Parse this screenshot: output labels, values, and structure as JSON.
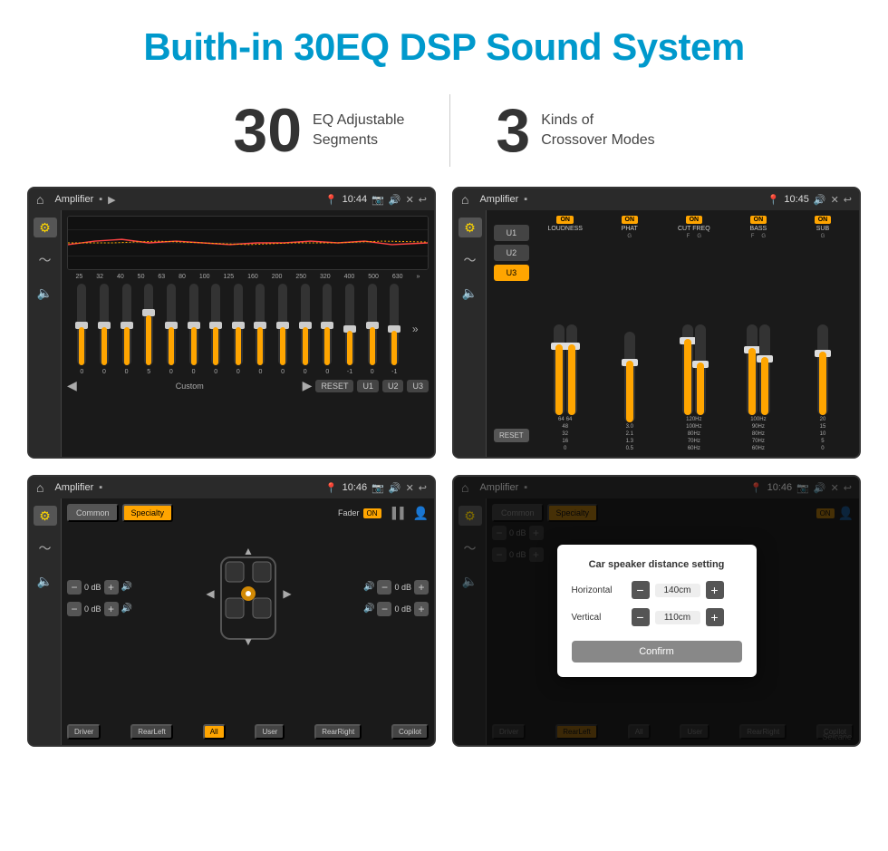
{
  "header": {
    "title": "Buith-in 30EQ DSP Sound System"
  },
  "stats": [
    {
      "number": "30",
      "label": "EQ Adjustable\nSegments"
    },
    {
      "number": "3",
      "label": "Kinds of\nCrossover Modes"
    }
  ],
  "screens": [
    {
      "id": "eq-screen",
      "statusBar": {
        "title": "Amplifier",
        "time": "10:44"
      },
      "type": "equalizer",
      "eqBands": [
        "25",
        "32",
        "40",
        "50",
        "63",
        "80",
        "100",
        "125",
        "160",
        "200",
        "250",
        "320",
        "400",
        "500",
        "630"
      ],
      "eqValues": [
        0,
        0,
        0,
        5,
        0,
        0,
        0,
        0,
        0,
        0,
        0,
        0,
        -1,
        0,
        -1
      ],
      "bottomButtons": [
        "Custom",
        "RESET",
        "U1",
        "U2",
        "U3"
      ]
    },
    {
      "id": "crossover-screen",
      "statusBar": {
        "title": "Amplifier",
        "time": "10:45"
      },
      "type": "crossover",
      "presets": [
        "U1",
        "U2",
        "U3"
      ],
      "activePreset": "U3",
      "channels": [
        "LOUDNESS",
        "PHAT",
        "CUT FREQ",
        "BASS",
        "SUB"
      ],
      "channelOn": [
        true,
        true,
        true,
        true,
        true
      ]
    },
    {
      "id": "specialty-screen",
      "statusBar": {
        "title": "Amplifier",
        "time": "10:46"
      },
      "type": "specialty",
      "tabs": [
        "Common",
        "Specialty"
      ],
      "activeTab": "Specialty",
      "fader": "ON",
      "dbValues": [
        "0 dB",
        "0 dB",
        "0 dB",
        "0 dB"
      ],
      "speakerButtons": [
        "Driver",
        "RearLeft",
        "All",
        "User",
        "RearRight",
        "Copilot"
      ]
    },
    {
      "id": "dialog-screen",
      "statusBar": {
        "title": "Amplifier",
        "time": "10:46"
      },
      "type": "dialog",
      "tabs": [
        "Common",
        "Specialty"
      ],
      "activeTab": "Specialty",
      "dialog": {
        "title": "Car speaker distance setting",
        "rows": [
          {
            "label": "Horizontal",
            "value": "140cm"
          },
          {
            "label": "Vertical",
            "value": "110cm"
          }
        ],
        "confirmLabel": "Confirm"
      },
      "dbValues": [
        "0 dB",
        "0 dB"
      ],
      "speakerButtons": [
        "Driver",
        "RearLeft",
        "All",
        "User",
        "RearRight",
        "Copilot"
      ]
    }
  ],
  "watermark": "Seicane"
}
